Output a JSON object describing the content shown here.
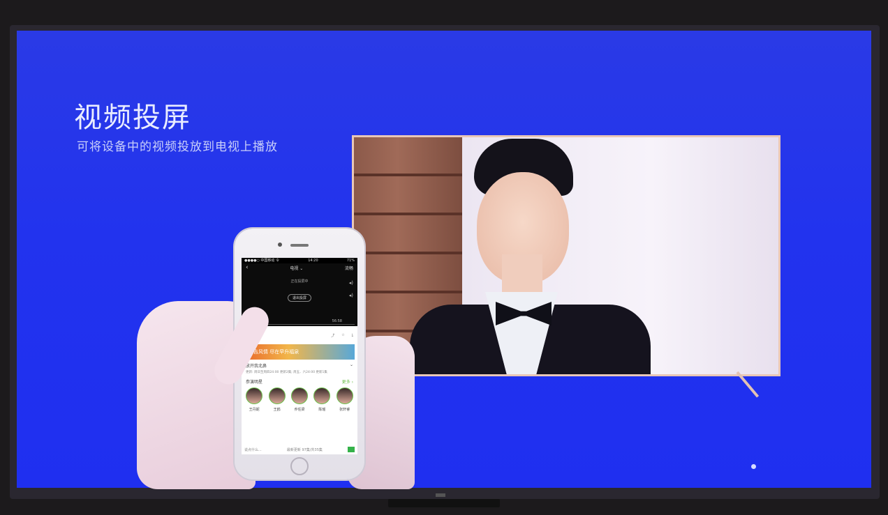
{
  "screen": {
    "title": "视频投屏",
    "subtitle": "可将设备中的视频投放到电视上播放"
  },
  "phone": {
    "status": {
      "carrier": "●●●●○ 中国移动 令",
      "time": "14:20",
      "battery": "71%"
    },
    "nav": {
      "tab": "电视 ⌄",
      "right": "流畅"
    },
    "casting_text": "正在投屏中",
    "exit_button": "退出投屏",
    "video_time": "56:58",
    "banner_text": "振吉风情 尽在早升福泉",
    "section_title": "放开我北鼻",
    "description": "更新: 周日至周四24:00 更新2集; 周五、六24:00 更新1集",
    "cast_title": "参演明星",
    "cast_more": "更多 ›",
    "cast": [
      "王丹妮",
      "王鸥",
      "乔任梁",
      "陈瑶",
      "张轩睿"
    ],
    "footer_left": "说点什么...",
    "footer_right": "最新更新 97集/共35集"
  },
  "colors": {
    "screen_blue": "#2233ee",
    "title": "#e9ecff"
  }
}
